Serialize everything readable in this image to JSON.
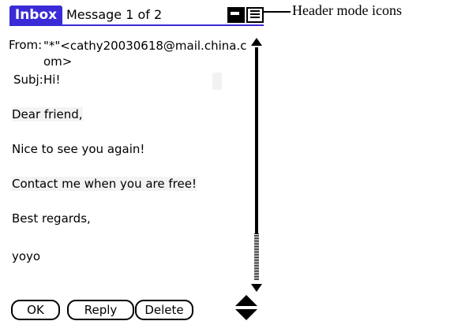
{
  "header": {
    "app_tab": "Inbox",
    "title": "Message 1 of 2",
    "mode_icons": [
      "short-header-icon",
      "full-header-icon"
    ]
  },
  "callout": {
    "label": "Header mode icons"
  },
  "message": {
    "from_label": "From:",
    "from_value": "\"*\"<cathy20030618@mail.china.com>",
    "subj_label": "Subj:",
    "subj_value": "Hi!",
    "body": [
      "Dear friend,",
      "Nice to see you again!",
      "Contact me when you are free!",
      "Best regards,",
      "yoyo"
    ]
  },
  "buttons": {
    "ok": "OK",
    "reply": "Reply",
    "delete": "Delete"
  },
  "colors": {
    "accent": "#3a2bd6"
  }
}
